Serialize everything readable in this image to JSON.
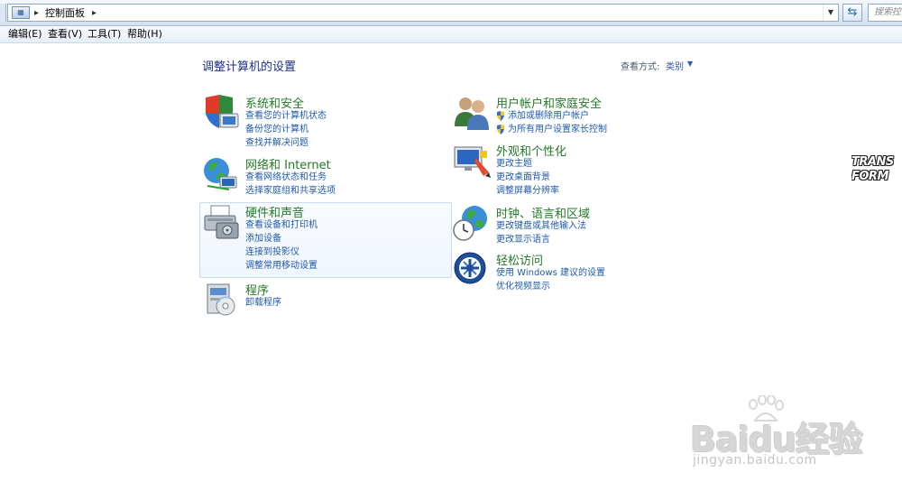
{
  "address_bar": {
    "breadcrumb": "控制面板",
    "search_placeholder": "搜索控"
  },
  "menu": {
    "items": [
      "编辑(E)",
      "查看(V)",
      "工具(T)",
      "帮助(H)"
    ]
  },
  "header": {
    "title": "调整计算机的设置",
    "view_label": "查看方式:",
    "view_value": "类别"
  },
  "categories_left": [
    {
      "icon": "shield-icon",
      "title": "系统和安全",
      "links": [
        "查看您的计算机状态",
        "备份您的计算机",
        "查找并解决问题"
      ]
    },
    {
      "icon": "globe-network-icon",
      "title": "网络和 Internet",
      "links": [
        "查看网络状态和任务",
        "选择家庭组和共享选项"
      ]
    },
    {
      "icon": "printer-icon",
      "title": "硬件和声音",
      "links": [
        "查看设备和打印机",
        "添加设备",
        "连接到投影仪",
        "调整常用移动设置"
      ]
    },
    {
      "icon": "programs-icon",
      "title": "程序",
      "links": [
        "卸载程序"
      ]
    }
  ],
  "categories_right": [
    {
      "icon": "users-icon",
      "title": "用户帐户和家庭安全",
      "links": [
        "添加或删除用户帐户",
        "为所有用户设置家长控制"
      ]
    },
    {
      "icon": "appearance-icon",
      "title": "外观和个性化",
      "links": [
        "更改主题",
        "更改桌面背景",
        "调整屏幕分辨率"
      ]
    },
    {
      "icon": "clock-globe-icon",
      "title": "时钟、语言和区域",
      "links": [
        "更改键盘或其他输入法",
        "更改显示语言"
      ]
    },
    {
      "icon": "ease-of-access-icon",
      "title": "轻松访问",
      "links": [
        "使用 Windows 建议的设置",
        "优化视频显示"
      ]
    }
  ],
  "watermarks": {
    "transformers": "TRANS FORM",
    "baidu": "Baidu经验",
    "baidu_url": "jingyan.baidu.com"
  },
  "colors": {
    "title_green": "#237a2a",
    "link_blue": "#1f5aa8",
    "page_title": "#1e3287"
  }
}
